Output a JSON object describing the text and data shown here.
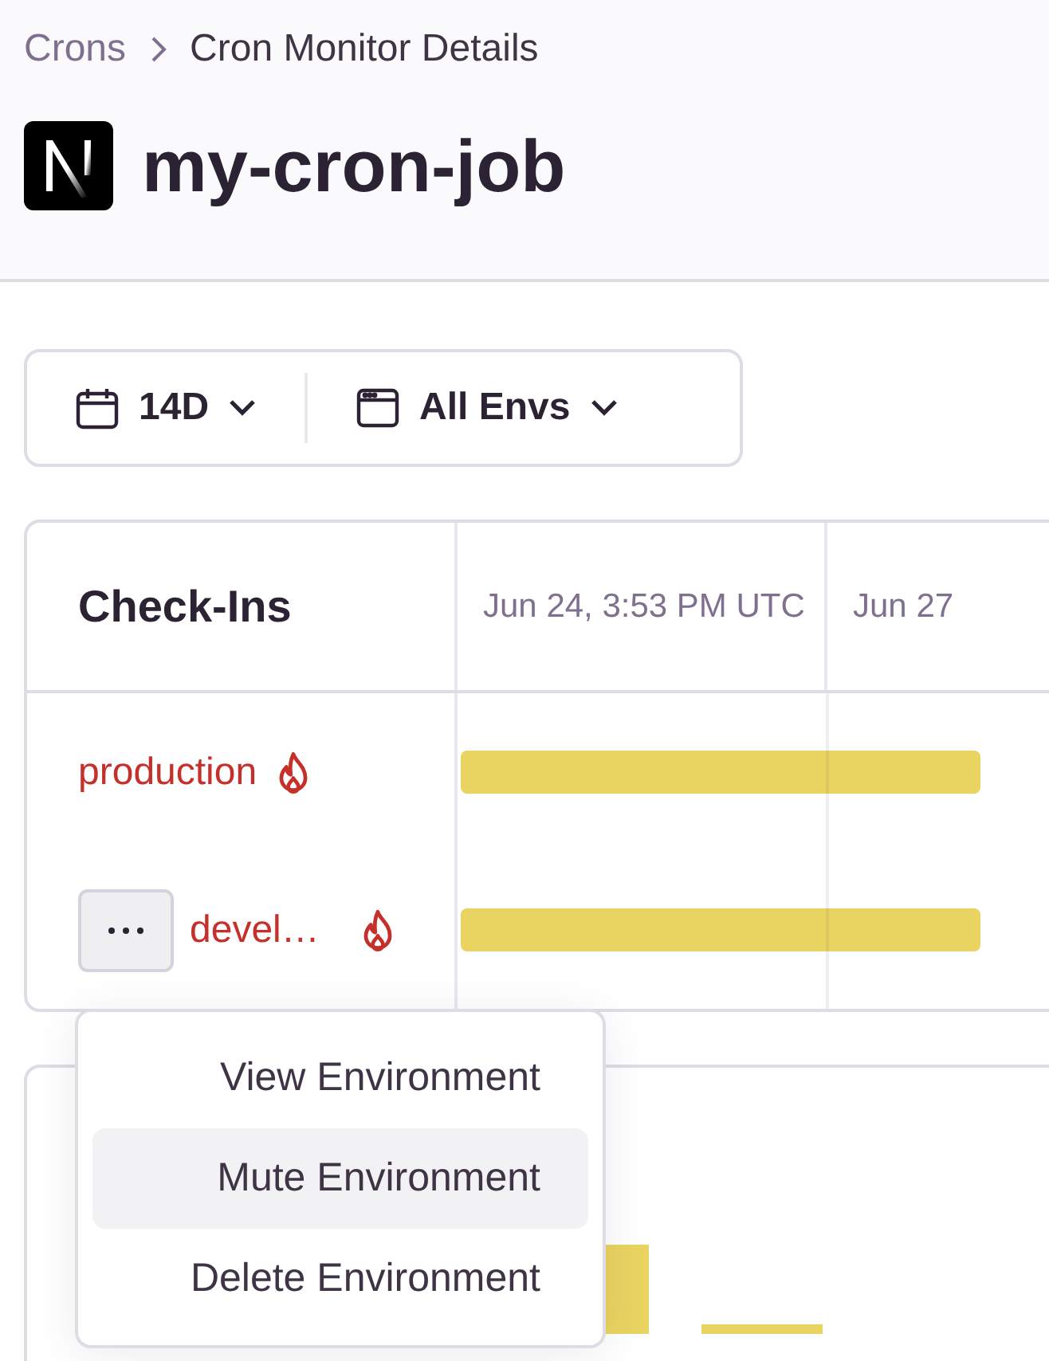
{
  "breadcrumbs": [
    {
      "label": "Crons",
      "link": true
    },
    {
      "label": "Cron Monitor Details",
      "link": false
    }
  ],
  "title": "my-cron-job",
  "filters": [
    {
      "kind": "calendar",
      "label": "14D"
    },
    {
      "kind": "window",
      "label": "All Envs"
    }
  ],
  "checkins": {
    "title": "Check-Ins",
    "timeline_labels": [
      "Jun 24, 3:53 PM UTC",
      "Jun 27"
    ],
    "environments": [
      {
        "name": "production",
        "failing": true,
        "menu_button": false
      },
      {
        "name": "devel…",
        "failing": true,
        "menu_button": true
      }
    ]
  },
  "menu": {
    "items": [
      {
        "label": "View Environment",
        "highlighted": false
      },
      {
        "label": "Mute Environment",
        "highlighted": true
      },
      {
        "label": "Delete Environment",
        "highlighted": false
      }
    ]
  }
}
